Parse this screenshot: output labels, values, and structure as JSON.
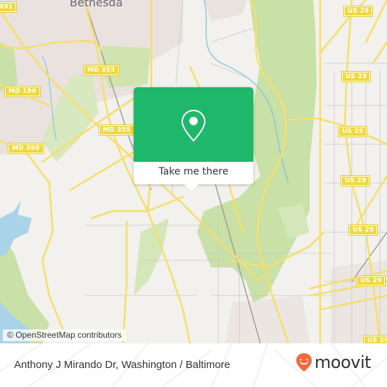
{
  "map": {
    "place_labels": [
      {
        "name": "Bethesda"
      }
    ],
    "route_shields": [
      {
        "label": "491"
      },
      {
        "label": "MD 355"
      },
      {
        "label": "MD 190"
      },
      {
        "label": "MD 355"
      },
      {
        "label": "MD 396"
      },
      {
        "label": "US 29"
      },
      {
        "label": "US 29"
      },
      {
        "label": "US 29"
      },
      {
        "label": "US 29"
      },
      {
        "label": "US 29"
      },
      {
        "label": "US 29"
      },
      {
        "label": "US 29"
      }
    ],
    "colors": {
      "land": "#f2f1ed",
      "park": "#c8dfa4",
      "water": "#a9d3e8",
      "road_major": "#f6df6b",
      "road_minor": "#bcbcbc",
      "urban": "#e8e0dc"
    },
    "attribution": "© OpenStreetMap contributors"
  },
  "popup": {
    "icon": "map-pin-icon",
    "action_label": "Take me there",
    "color": "#1fb86b"
  },
  "footer": {
    "address": "Anthony J Mirando Dr, Washington / Baltimore",
    "brand": "moovit",
    "brand_color": "#f26a3d"
  }
}
